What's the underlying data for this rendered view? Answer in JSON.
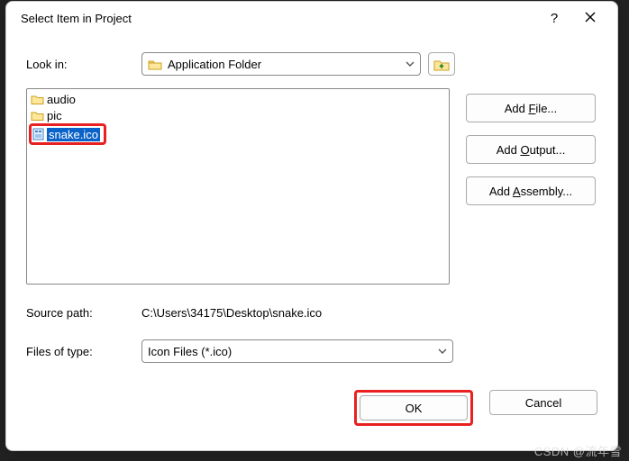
{
  "title": "Select Item in Project",
  "look_in_label": "Look in:",
  "look_in_value": "Application Folder",
  "list": {
    "folder1": "audio",
    "folder2": "pic",
    "selected": "snake.ico"
  },
  "side": {
    "add_file": "Add File...",
    "add_output": "Add Output...",
    "add_assembly": "Add Assembly..."
  },
  "source_label": "Source path:",
  "source_value": "C:\\Users\\34175\\Desktop\\snake.ico",
  "filetype_label": "Files of type:",
  "filetype_value": "Icon Files (*.ico)",
  "ok": "OK",
  "cancel": "Cancel",
  "watermark": "CSDN @流年雪"
}
